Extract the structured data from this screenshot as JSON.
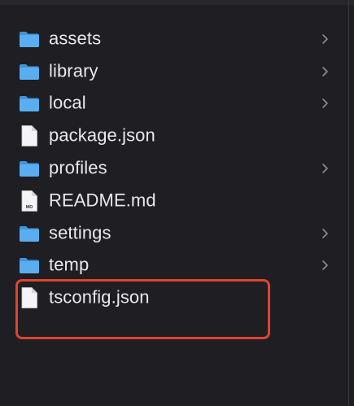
{
  "accent_color": "#e0432f",
  "folder_color": "#4fa3e8",
  "items": [
    {
      "label": "assets",
      "kind": "folder",
      "icon": "folder-icon",
      "has_children": true
    },
    {
      "label": "library",
      "kind": "folder",
      "icon": "folder-icon",
      "has_children": true
    },
    {
      "label": "local",
      "kind": "folder",
      "icon": "folder-icon",
      "has_children": true
    },
    {
      "label": "package.json",
      "kind": "file",
      "icon": "file-icon",
      "has_children": false
    },
    {
      "label": "profiles",
      "kind": "folder",
      "icon": "folder-icon",
      "has_children": true
    },
    {
      "label": "README.md",
      "kind": "file",
      "icon": "markdown-file-icon",
      "icon_text": "MD",
      "has_children": false
    },
    {
      "label": "settings",
      "kind": "folder",
      "icon": "folder-icon",
      "has_children": true
    },
    {
      "label": "temp",
      "kind": "folder",
      "icon": "folder-icon",
      "has_children": true
    },
    {
      "label": "tsconfig.json",
      "kind": "file",
      "icon": "file-icon",
      "has_children": false,
      "highlighted": true
    }
  ]
}
